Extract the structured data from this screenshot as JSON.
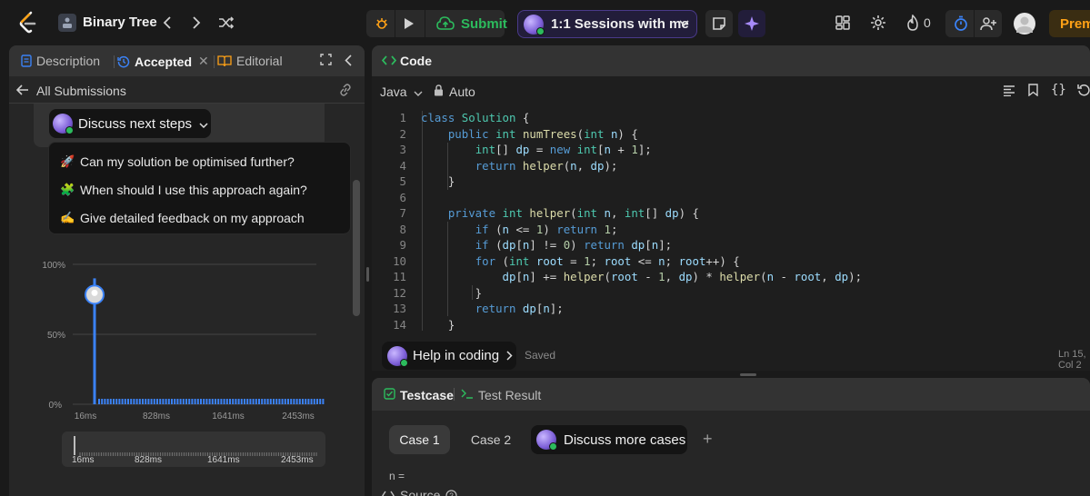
{
  "topbar": {
    "problem_title": "Binary Tree",
    "submit_label": "Submit",
    "sessions_label": "1:1 Sessions with me",
    "fire_count": "0",
    "premium_label": "Premium"
  },
  "left_panel": {
    "tabs": [
      {
        "label": "Description"
      },
      {
        "label": "Accepted"
      },
      {
        "label": "Editorial"
      }
    ],
    "back_label": "All Submissions",
    "discuss_label": "Discuss next steps",
    "suggestions": [
      {
        "emoji": "🚀",
        "label": "Can my solution be optimised further?"
      },
      {
        "emoji": "🧩",
        "label": "When should I use this approach again?"
      },
      {
        "emoji": "✍️",
        "label": "Give detailed feedback on my approach"
      }
    ]
  },
  "chart_data": {
    "type": "bar",
    "y_ticks": [
      "100%",
      "50%",
      "0%"
    ],
    "x_ticks": [
      "16ms",
      "828ms",
      "1641ms",
      "2453ms"
    ],
    "range_ticks": [
      "16ms",
      "828ms",
      "1641ms",
      "2453ms"
    ],
    "highlight_x": "16ms",
    "highlight_y": 0.9,
    "ylim": [
      0,
      1
    ]
  },
  "code_panel": {
    "title": "Code",
    "language": "Java",
    "auto_label": "Auto",
    "lines": [
      "class Solution {",
      "    public int numTrees(int n) {",
      "        int[] dp = new int[n + 1];",
      "        return helper(n, dp);",
      "    }",
      "",
      "    private int helper(int n, int[] dp) {",
      "        if (n <= 1) return 1;",
      "        if (dp[n] != 0) return dp[n];",
      "        for (int root = 1; root <= n; root++) {",
      "            dp[n] += helper(root - 1, dp) * helper(n - root, dp);",
      "        }",
      "        return dp[n];",
      "    }"
    ],
    "help_label": "Help in coding",
    "saved_label": "Saved",
    "cursor_label": "Ln 15, Col 2"
  },
  "test_panel": {
    "testcase_tab": "Testcase",
    "result_tab": "Test Result",
    "cases": [
      {
        "label": "Case 1"
      },
      {
        "label": "Case 2"
      }
    ],
    "discuss_cases_label": "Discuss more cases",
    "n_label": "n =",
    "source_label": "Source"
  },
  "colors": {
    "accent_green": "#2cbb5d",
    "chart_blue": "#3b82f6",
    "premium_orange": "#ffa116"
  }
}
